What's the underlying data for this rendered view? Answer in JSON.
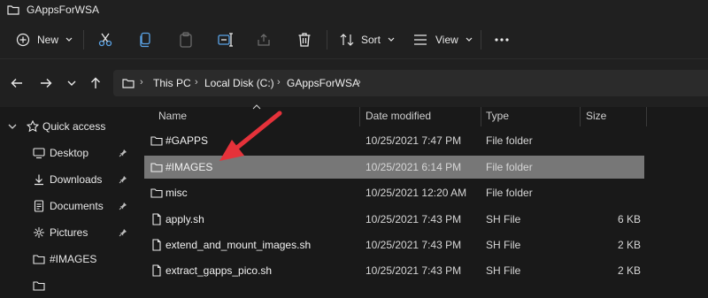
{
  "window": {
    "title": "GAppsForWSA"
  },
  "toolbar": {
    "new_label": "New",
    "sort_label": "Sort",
    "view_label": "View"
  },
  "address": {
    "crumbs": [
      "This PC",
      "Local Disk (C:)",
      "GAppsForWSA"
    ]
  },
  "sidebar": {
    "items": [
      {
        "label": "Quick access",
        "icon": "star-icon"
      },
      {
        "label": "Desktop",
        "icon": "desktop-icon",
        "pinned": true
      },
      {
        "label": "Downloads",
        "icon": "download-icon",
        "pinned": true
      },
      {
        "label": "Documents",
        "icon": "documents-icon",
        "pinned": true
      },
      {
        "label": "Pictures",
        "icon": "pictures-icon",
        "pinned": true
      },
      {
        "label": "#IMAGES",
        "icon": "folder-icon",
        "pinned": false
      }
    ]
  },
  "columns": {
    "name": "Name",
    "date": "Date modified",
    "type": "Type",
    "size": "Size"
  },
  "files": [
    {
      "name": "#GAPPS",
      "date": "10/25/2021 7:47 PM",
      "type": "File folder",
      "size": "",
      "kind": "folder"
    },
    {
      "name": "#IMAGES",
      "date": "10/25/2021 6:14 PM",
      "type": "File folder",
      "size": "",
      "kind": "folder",
      "selected": true
    },
    {
      "name": "misc",
      "date": "10/25/2021 12:20 AM",
      "type": "File folder",
      "size": "",
      "kind": "folder"
    },
    {
      "name": "apply.sh",
      "date": "10/25/2021 7:43 PM",
      "type": "SH File",
      "size": "6 KB",
      "kind": "file"
    },
    {
      "name": "extend_and_mount_images.sh",
      "date": "10/25/2021 7:43 PM",
      "type": "SH File",
      "size": "2 KB",
      "kind": "file"
    },
    {
      "name": "extract_gapps_pico.sh",
      "date": "10/25/2021 7:43 PM",
      "type": "SH File",
      "size": "2 KB",
      "kind": "file"
    }
  ],
  "colors": {
    "accent": "#e5323a",
    "selection": "#777777",
    "background": "#191919"
  }
}
